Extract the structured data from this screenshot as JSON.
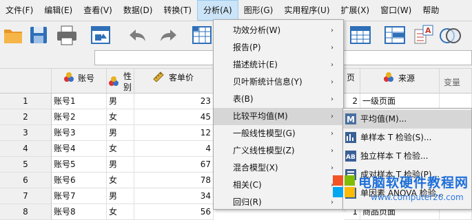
{
  "menubar": [
    {
      "label": "文件(F)"
    },
    {
      "label": "编辑(E)"
    },
    {
      "label": "查看(V)"
    },
    {
      "label": "数据(D)"
    },
    {
      "label": "转换(T)"
    },
    {
      "label": "分析(A)",
      "active": true
    },
    {
      "label": "图形(G)"
    },
    {
      "label": "实用程序(U)"
    },
    {
      "label": "扩展(X)"
    },
    {
      "label": "窗口(W)"
    },
    {
      "label": "帮助"
    }
  ],
  "columns": {
    "account": "账号",
    "gender_l1": "性",
    "gender_l2": "别",
    "price": "客单价",
    "source": "来源",
    "var": "变量",
    "obscured": "页"
  },
  "rows": [
    {
      "n": "1",
      "account": "账号1",
      "gender": "男",
      "price": "23",
      "src_num": "2",
      "source": "一级页面"
    },
    {
      "n": "2",
      "account": "账号2",
      "gender": "女",
      "price": "45",
      "src_num": "",
      "source": ""
    },
    {
      "n": "3",
      "account": "账号3",
      "gender": "男",
      "price": "12",
      "src_num": "",
      "source": ""
    },
    {
      "n": "4",
      "account": "账号4",
      "gender": "女",
      "price": "4",
      "src_num": "",
      "source": ""
    },
    {
      "n": "5",
      "account": "账号5",
      "gender": "男",
      "price": "67",
      "src_num": "",
      "source": ""
    },
    {
      "n": "6",
      "account": "账号6",
      "gender": "女",
      "price": "78",
      "src_num": "",
      "source": ""
    },
    {
      "n": "7",
      "account": "账号7",
      "gender": "男",
      "price": "34",
      "src_num": "",
      "source": ""
    },
    {
      "n": "8",
      "account": "账号8",
      "gender": "女",
      "price": "56",
      "src_num": "1",
      "source": "商品页面"
    }
  ],
  "analyze_menu": [
    {
      "label": "功效分析(W)",
      "arrow": "›"
    },
    {
      "label": "报告(P)",
      "arrow": "›"
    },
    {
      "label": "描述统计(E)",
      "arrow": "›"
    },
    {
      "label": "贝叶斯统计信息(Y)",
      "arrow": "›"
    },
    {
      "label": "表(B)",
      "arrow": "›"
    },
    {
      "label": "比较平均值(M)",
      "arrow": "›",
      "highlight": true
    },
    {
      "label": "一般线性模型(G)",
      "arrow": "›"
    },
    {
      "label": "广义线性模型(Z)",
      "arrow": "›"
    },
    {
      "label": "混合模型(X)",
      "arrow": "›"
    },
    {
      "label": "相关(C)",
      "arrow": "›"
    },
    {
      "label": "回归(R)",
      "arrow": "›"
    }
  ],
  "compare_means_submenu": [
    {
      "label": "平均值(M)...",
      "icon": "means-icon",
      "highlight": true
    },
    {
      "label": "单样本 T 检验(S)...",
      "icon": "one-sample-t-icon"
    },
    {
      "label": "独立样本 T 检验...",
      "icon": "independent-t-icon"
    },
    {
      "label": "成对样本 T 检验(P)...",
      "icon": "paired-t-icon"
    },
    {
      "label": "单因素 ANOVA 检验...",
      "icon": "anova-icon"
    }
  ],
  "watermark": {
    "line1": "电脑软硬件教程网",
    "line2": "www.computer26.com"
  },
  "colors": {
    "highlight": "#d6d6d6",
    "menu_active": "#cce4f7",
    "folder": "#f0a030",
    "toolbar_blue": "#2e6fb8"
  }
}
